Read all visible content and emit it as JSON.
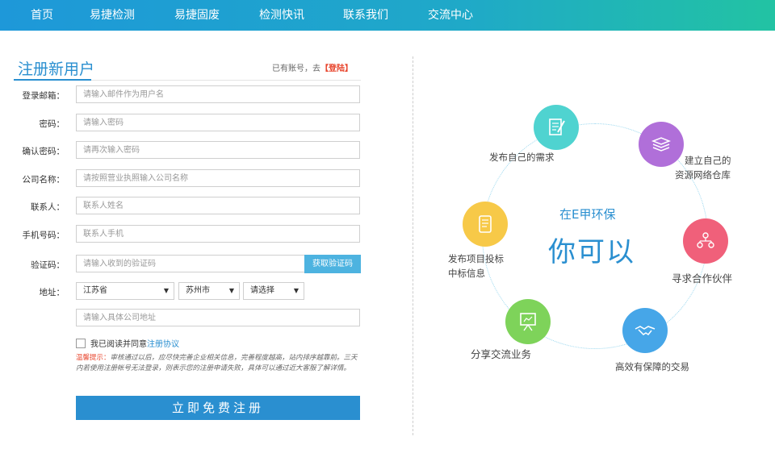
{
  "nav": {
    "items": [
      "首页",
      "易捷检测",
      "易捷固废",
      "检测快讯",
      "联系我们",
      "交流中心"
    ]
  },
  "form": {
    "title": "注册新用户",
    "login_hint": "已有账号，去",
    "login_link": "【登陆】",
    "fields": {
      "email": {
        "label": "登录邮箱：",
        "placeholder": "请输入邮件作为用户名"
      },
      "password": {
        "label": "密码：",
        "placeholder": "请输入密码"
      },
      "confirm": {
        "label": "确认密码：",
        "placeholder": "请再次输入密码"
      },
      "company": {
        "label": "公司名称：",
        "placeholder": "请按照营业执照输入公司名称"
      },
      "contact": {
        "label": "联系人：",
        "placeholder": "联系人姓名"
      },
      "phone": {
        "label": "手机号码：",
        "placeholder": "联系人手机"
      },
      "code": {
        "label": "验证码：",
        "placeholder": "请输入收到的验证码",
        "button": "获取验证码"
      },
      "address": {
        "label": "地址：",
        "province": "江苏省",
        "city": "苏州市",
        "district": "请选择",
        "placeholder": "请输入具体公司地址"
      }
    },
    "agree_text": "我已阅读并同意",
    "agree_link": "注册协议",
    "tip_label": "温馨提示：",
    "tip_text": "审核通过以后，应尽快完善企业相关信息，完善程度越高，站内排序越靠前。三天内若使用注册帐号无法登录，则表示您的注册申请失败，具体可以通过近大客服了解详情。",
    "submit": "立即免费注册"
  },
  "diagram": {
    "center_small": "在E甲环保",
    "center_big": "你可以",
    "nodes": [
      {
        "label": "发布自己的需求",
        "color": "#4fd3d0",
        "icon": "document-edit-icon"
      },
      {
        "label_line1": "建立自己的",
        "label_line2": "资源网络仓库",
        "color": "#b06fd9",
        "icon": "database-icon"
      },
      {
        "label": "寻求合作伙伴",
        "color": "#f0607a",
        "icon": "people-network-icon"
      },
      {
        "label": "高效有保障的交易",
        "color": "#46a6e8",
        "icon": "handshake-icon"
      },
      {
        "label": "分享交流业务",
        "color": "#7ed35a",
        "icon": "presentation-board-icon"
      },
      {
        "label_line1": "发布项目投标",
        "label_line2": "中标信息",
        "color": "#f7c948",
        "icon": "scroll-icon"
      }
    ]
  }
}
